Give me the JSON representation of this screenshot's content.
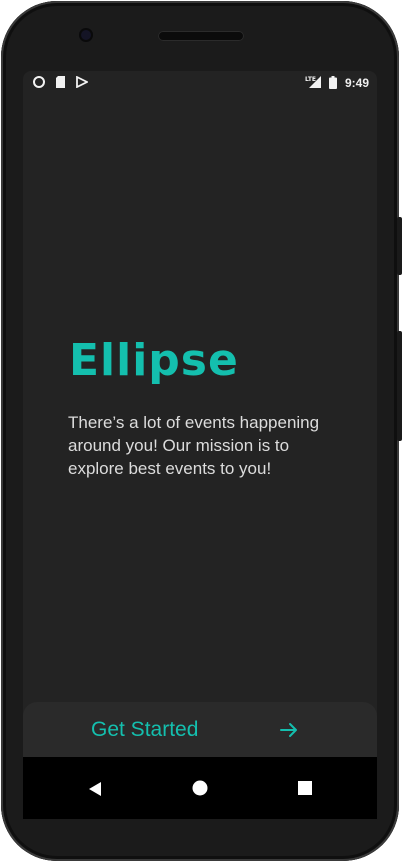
{
  "status_bar": {
    "time": "9:49",
    "network_label": "LTE",
    "left_icons": [
      "record-icon",
      "sim-card-icon",
      "play-store-icon"
    ],
    "right_icons": [
      "lte-signal-icon",
      "battery-icon"
    ]
  },
  "app": {
    "logo_text": "Ellipse",
    "tagline": "There’s a lot of events happening around you! Our mission is to explore best events to you!"
  },
  "cta": {
    "label": "Get Started",
    "icon": "arrow-right-icon"
  },
  "nav_bar": {
    "buttons": [
      "back-icon",
      "home-icon",
      "recents-icon"
    ]
  },
  "colors": {
    "accent": "#14bfae",
    "background": "#232323",
    "text": "#dcdcdc",
    "cta_background": "#2a2a2a"
  }
}
